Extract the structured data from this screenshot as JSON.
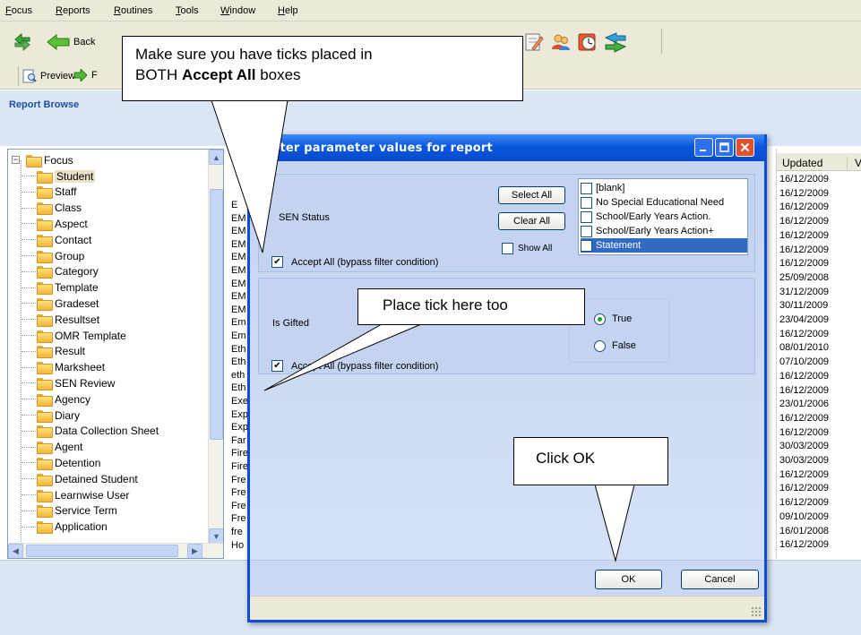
{
  "menu": [
    "Focus",
    "Reports",
    "Routines",
    "Tools",
    "Window",
    "Help"
  ],
  "toolbar": {
    "back_label": "Back",
    "preview_label": "Preview",
    "clipped_label": "F"
  },
  "browse": {
    "title": "Report Browse"
  },
  "tree": {
    "root": "Focus",
    "items": [
      "Student",
      "Staff",
      "Class",
      "Aspect",
      "Contact",
      "Group",
      "Category",
      "Template",
      "Gradeset",
      "Resultset",
      "OMR Template",
      "Result",
      "Marksheet",
      "SEN Review",
      "Agency",
      "Diary",
      "Data Collection Sheet",
      "Agent",
      "Detention",
      "Detained Student",
      "Learnwise User",
      "Service Term",
      "Application"
    ],
    "selected": "Student"
  },
  "middle_list": [
    "E",
    "EM",
    "EM",
    "EM",
    "EM",
    "EM",
    "EM",
    "EM",
    "EM",
    "Em",
    "Em",
    "Eth",
    "Eth",
    "eth",
    "Eth",
    "Exe",
    "Exp",
    "Exp",
    "Far",
    "Fire",
    "Fire",
    "Fre",
    "Fre",
    "Fre",
    "Fre",
    "fre",
    "Ho"
  ],
  "right_list": {
    "header": "Updated",
    "header2": "V",
    "dates": [
      "16/12/2009",
      "16/12/2009",
      "16/12/2009",
      "16/12/2009",
      "16/12/2009",
      "16/12/2009",
      "16/12/2009",
      "25/09/2008",
      "31/12/2009",
      "30/11/2009",
      "23/04/2009",
      "16/12/2009",
      "08/01/2010",
      "07/10/2009",
      "16/12/2009",
      "16/12/2009",
      "23/01/2006",
      "16/12/2009",
      "16/12/2009",
      "30/03/2009",
      "30/03/2009",
      "16/12/2009",
      "16/12/2009",
      "16/12/2009",
      "09/10/2009",
      "16/01/2008",
      "16/12/2009"
    ]
  },
  "dialog": {
    "title": "nter parameter values for report",
    "sen": {
      "label": "SEN Status",
      "select_all": "Select All",
      "clear_all": "Clear All",
      "show_all": "Show All",
      "options": [
        "[blank]",
        "No Special Educational Need",
        "School/Early Years Action.",
        "School/Early Years Action+",
        "Statement"
      ],
      "selected_option": "Statement",
      "accept_all": "Accept All (bypass filter condition)"
    },
    "gifted": {
      "label": "Is Gifted",
      "option_true": "True",
      "option_false": "False",
      "selected": "True",
      "accept_all": "Accept All (bypass filter condition)"
    },
    "ok": "OK",
    "cancel": "Cancel"
  },
  "callouts": {
    "accept_line1": "Make sure you have ticks placed in",
    "accept_line2_pre": "BOTH ",
    "accept_line2_bold": "Accept All",
    "accept_line2_post": " boxes",
    "tick": "Place tick here too",
    "ok": "Click OK"
  }
}
